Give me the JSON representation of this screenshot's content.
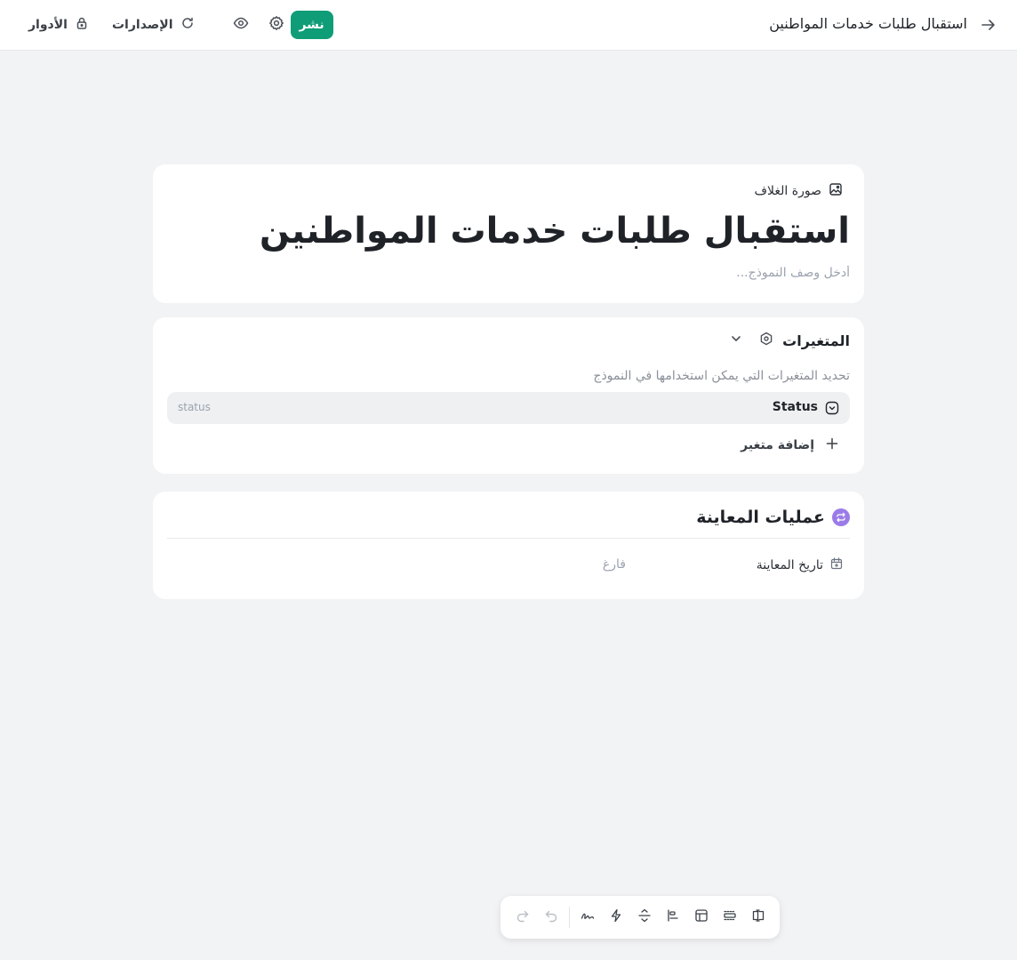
{
  "topbar": {
    "title": "استقبال طلبات خدمات المواطنين",
    "publish_label": "نشر",
    "versions_label": "الإصدارات",
    "roles_label": "الأدوار",
    "icons": {
      "back": "arrow-right-icon",
      "settings": "gear-icon",
      "preview": "eye-icon",
      "versions": "refresh-icon",
      "roles": "lock-icon"
    }
  },
  "form": {
    "cover_label": "صورة الغلاف",
    "title": "استقبال طلبات خدمات المواطنين",
    "description_placeholder": "أدخل وصف النموذج...",
    "description_value": ""
  },
  "variables": {
    "title": "المتغيرات",
    "description": "تحديد المتغيرات التي يمكن استخدامها في النموذج",
    "items": [
      {
        "name": "Status",
        "key": "status"
      }
    ],
    "add_label": "إضافة متغير"
  },
  "operations": {
    "title": "عمليات المعاينة",
    "fields": [
      {
        "label": "تاريخ المعاينة",
        "value": "فارغ"
      }
    ]
  },
  "toolbar": {
    "tools": [
      "text-field-icon",
      "section-icon",
      "table-icon",
      "align-icon",
      "split-icon",
      "lightning-icon",
      "signature-icon"
    ],
    "undo": "undo-icon",
    "redo": "redo-icon"
  },
  "colors": {
    "accent": "#0f9d77",
    "badge": "#9b7be8",
    "background": "#f2f3f5"
  }
}
